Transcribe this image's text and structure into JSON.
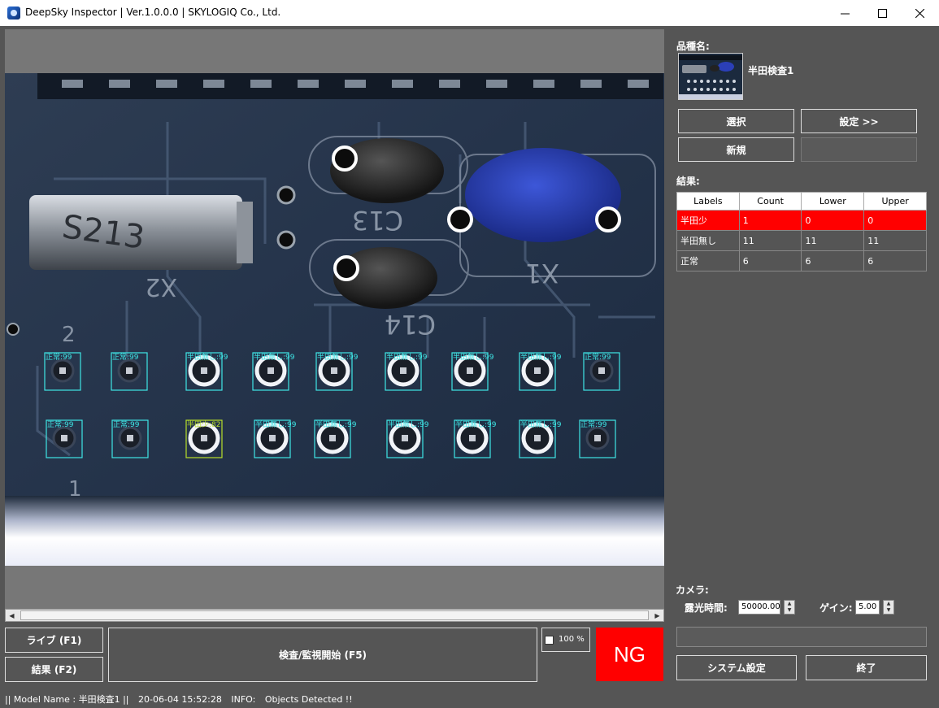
{
  "window": {
    "title": "DeepSky Inspector | Ver.1.0.0.0 | SKYLOGIQ Co., Ltd."
  },
  "detections": [
    {
      "label": "正常:99"
    },
    {
      "label": "正常:99"
    },
    {
      "label": "半田無し:99"
    },
    {
      "label": "半田無し:99"
    },
    {
      "label": "半田無し:99"
    },
    {
      "label": "半田無し:99"
    },
    {
      "label": "半田無し:99"
    },
    {
      "label": "半田無し:99"
    },
    {
      "label": "正常:99"
    },
    {
      "label": "正常:99"
    },
    {
      "label": "正常:99"
    },
    {
      "label": "半田少:82"
    },
    {
      "label": "半田無し:99"
    },
    {
      "label": "半田無し:99"
    },
    {
      "label": "半田無し:99"
    },
    {
      "label": "半田無し:99"
    },
    {
      "label": "半田無し:99"
    },
    {
      "label": "正常:99"
    }
  ],
  "controls": {
    "live_button": "ライブ (F1)",
    "result_button": "結果 (F2)",
    "inspect_button": "検査/監視開始 (F5)",
    "zoom_label": "100 %",
    "judgement": "NG"
  },
  "product": {
    "heading": "品種名:",
    "name": "半田検査1",
    "select_button": "選択",
    "settings_button": "設定 >>",
    "new_button": "新規"
  },
  "results": {
    "heading": "結果:",
    "columns": [
      "Labels",
      "Count",
      "Lower",
      "Upper"
    ],
    "rows": [
      {
        "label": "半田少",
        "count": "1",
        "lower": "0",
        "upper": "0",
        "status": "ng"
      },
      {
        "label": "半田無し",
        "count": "11",
        "lower": "11",
        "upper": "11",
        "status": "ok"
      },
      {
        "label": "正常",
        "count": "6",
        "lower": "6",
        "upper": "6",
        "status": "ok"
      }
    ]
  },
  "camera": {
    "heading": "カメラ:",
    "exposure_label": "露光時間:",
    "exposure_value": "50000.00",
    "gain_label": "ゲイン:",
    "gain_value": "5.00"
  },
  "footer_buttons": {
    "system_settings": "システム設定",
    "exit": "終了"
  },
  "statusbar": {
    "model": "|| Model Name : 半田検査1 ||",
    "timestamp": "20-06-04 15:52:28",
    "info_tag": "INFO:",
    "message": "Objects Detected !!"
  },
  "colors": {
    "ng_red": "#ff0000",
    "box_ok": "#3fe6e6",
    "box_warn": "#b8e02a"
  }
}
